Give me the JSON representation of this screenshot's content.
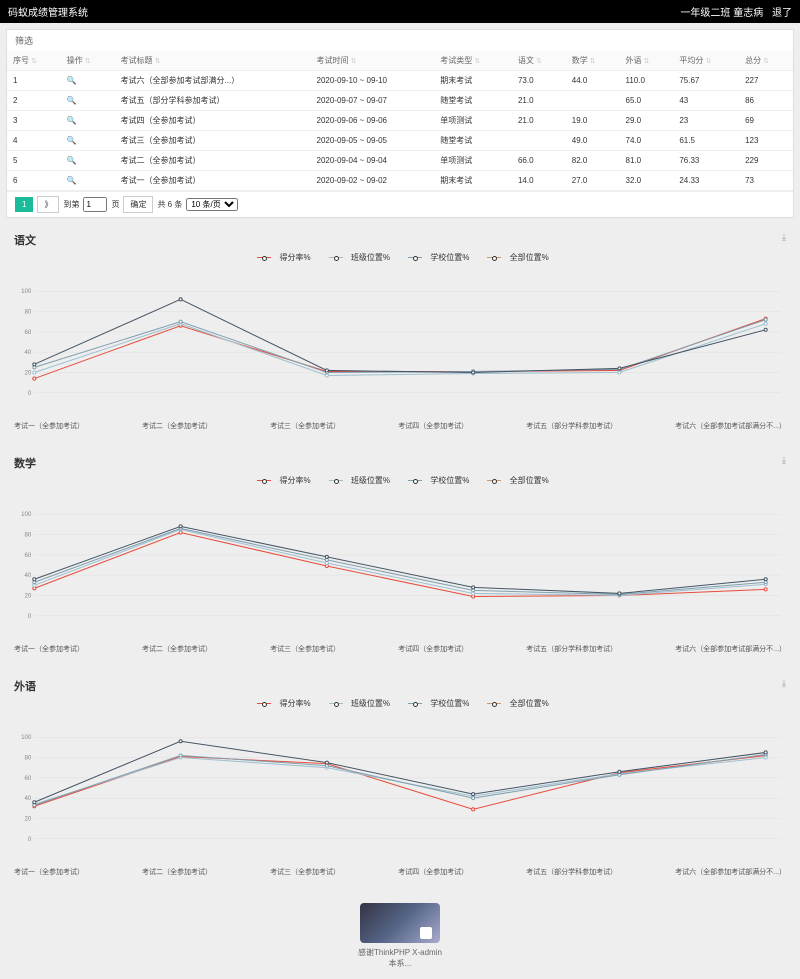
{
  "header": {
    "title": "码蚁成绩管理系统",
    "classInfo": "一年级二班 童志病",
    "logout": "退了"
  },
  "filter": "筛选",
  "table": {
    "columns": [
      "序号",
      "操作",
      "考试标题",
      "考试时间",
      "考试类型",
      "语文",
      "数学",
      "外语",
      "平均分",
      "总分"
    ],
    "rows": [
      {
        "seq": "1",
        "title": "考试六（全部参加考试部满分...）",
        "time": "2020-09-10 ~ 09-10",
        "type": "期末考试",
        "yu": "73.0",
        "sh": "44.0",
        "wy": "110.0",
        "avg": "75.67",
        "total": "227"
      },
      {
        "seq": "2",
        "title": "考试五（部分学科参加考试）",
        "time": "2020-09-07 ~ 09-07",
        "type": "随堂考试",
        "yu": "21.0",
        "sh": "",
        "wy": "65.0",
        "avg": "43",
        "total": "86"
      },
      {
        "seq": "3",
        "title": "考试四（全参加考试）",
        "time": "2020-09-06 ~ 09-06",
        "type": "单项测试",
        "yu": "21.0",
        "sh": "19.0",
        "wy": "29.0",
        "avg": "23",
        "total": "69"
      },
      {
        "seq": "4",
        "title": "考试三（全参加考试）",
        "time": "2020-09-05 ~ 09-05",
        "type": "随堂考试",
        "yu": "",
        "sh": "49.0",
        "wy": "74.0",
        "avg": "61.5",
        "total": "123"
      },
      {
        "seq": "5",
        "title": "考试二（全参加考试）",
        "time": "2020-09-04 ~ 09-04",
        "type": "单项测试",
        "yu": "66.0",
        "sh": "82.0",
        "wy": "81.0",
        "avg": "76.33",
        "total": "229"
      },
      {
        "seq": "6",
        "title": "考试一（全参加考试）",
        "time": "2020-09-02 ~ 09-02",
        "type": "期末考试",
        "yu": "14.0",
        "sh": "27.0",
        "wy": "32.0",
        "avg": "24.33",
        "total": "73"
      }
    ]
  },
  "pager": {
    "page": "1",
    "arrow": "》",
    "inputLabel": "到第",
    "goBtn": "确定",
    "countText": "共 6 条",
    "perPage": "10 条/页"
  },
  "legend": [
    "得分率%",
    "班级位置%",
    "学校位置%",
    "全部位置%"
  ],
  "xLabels": [
    "考试一（全参加考试）",
    "考试二（全参加考试）",
    "考试三（全参加考试）",
    "考试四（全参加考试）",
    "考试五（部分学科参加考试）",
    "考试六（全部参加考试部满分不...）"
  ],
  "charts": [
    {
      "title": "语文",
      "series": [
        {
          "color": "#e74c3c",
          "vals": [
            14,
            66,
            21,
            21,
            22,
            73
          ]
        },
        {
          "color": "#a0c0d0",
          "vals": [
            20,
            68,
            17,
            19,
            20,
            68
          ]
        },
        {
          "color": "#7fa0b0",
          "vals": [
            25,
            70,
            20,
            21,
            23,
            72
          ]
        },
        {
          "color": "#445566",
          "vals": [
            28,
            92,
            22,
            20,
            24,
            62
          ]
        }
      ]
    },
    {
      "title": "数学",
      "series": [
        {
          "color": "#e74c3c",
          "vals": [
            27,
            82,
            49,
            19,
            20,
            26
          ]
        },
        {
          "color": "#a0c0d0",
          "vals": [
            30,
            85,
            52,
            22,
            20,
            31
          ]
        },
        {
          "color": "#7fa0b0",
          "vals": [
            33,
            86,
            55,
            25,
            21,
            33
          ]
        },
        {
          "color": "#445566",
          "vals": [
            36,
            88,
            58,
            28,
            22,
            36
          ]
        }
      ]
    },
    {
      "title": "外语",
      "series": [
        {
          "color": "#e74c3c",
          "vals": [
            32,
            81,
            74,
            29,
            65,
            82
          ]
        },
        {
          "color": "#a0c0d0",
          "vals": [
            34,
            80,
            70,
            42,
            64,
            80
          ]
        },
        {
          "color": "#7fa0b0",
          "vals": [
            33,
            82,
            72,
            40,
            63,
            83
          ]
        },
        {
          "color": "#445566",
          "vals": [
            36,
            96,
            75,
            44,
            66,
            85
          ]
        }
      ]
    }
  ],
  "chart_data": [
    {
      "type": "line",
      "title": "语文",
      "ylabel": "%",
      "ylim": [
        0,
        100
      ],
      "categories": [
        "考试一",
        "考试二",
        "考试三",
        "考试四",
        "考试五",
        "考试六"
      ],
      "series": [
        {
          "name": "得分率%",
          "values": [
            14,
            66,
            21,
            21,
            22,
            73
          ]
        },
        {
          "name": "班级位置%",
          "values": [
            20,
            68,
            17,
            19,
            20,
            68
          ]
        },
        {
          "name": "学校位置%",
          "values": [
            25,
            70,
            20,
            21,
            23,
            72
          ]
        },
        {
          "name": "全部位置%",
          "values": [
            28,
            92,
            22,
            20,
            24,
            62
          ]
        }
      ]
    },
    {
      "type": "line",
      "title": "数学",
      "ylabel": "%",
      "ylim": [
        0,
        100
      ],
      "categories": [
        "考试一",
        "考试二",
        "考试三",
        "考试四",
        "考试五",
        "考试六"
      ],
      "series": [
        {
          "name": "得分率%",
          "values": [
            27,
            82,
            49,
            19,
            20,
            26
          ]
        },
        {
          "name": "班级位置%",
          "values": [
            30,
            85,
            52,
            22,
            20,
            31
          ]
        },
        {
          "name": "学校位置%",
          "values": [
            33,
            86,
            55,
            25,
            21,
            33
          ]
        },
        {
          "name": "全部位置%",
          "values": [
            36,
            88,
            58,
            28,
            22,
            36
          ]
        }
      ]
    },
    {
      "type": "line",
      "title": "外语",
      "ylabel": "%",
      "ylim": [
        0,
        100
      ],
      "categories": [
        "考试一",
        "考试二",
        "考试三",
        "考试四",
        "考试五",
        "考试六"
      ],
      "series": [
        {
          "name": "得分率%",
          "values": [
            32,
            81,
            74,
            29,
            65,
            82
          ]
        },
        {
          "name": "班级位置%",
          "values": [
            34,
            80,
            70,
            42,
            64,
            80
          ]
        },
        {
          "name": "学校位置%",
          "values": [
            33,
            82,
            72,
            40,
            63,
            83
          ]
        },
        {
          "name": "全部位置%",
          "values": [
            36,
            96,
            75,
            44,
            66,
            85
          ]
        }
      ]
    }
  ],
  "footer": {
    "line1": "感谢ThinkPHP X-admin",
    "line2": "本系..."
  }
}
